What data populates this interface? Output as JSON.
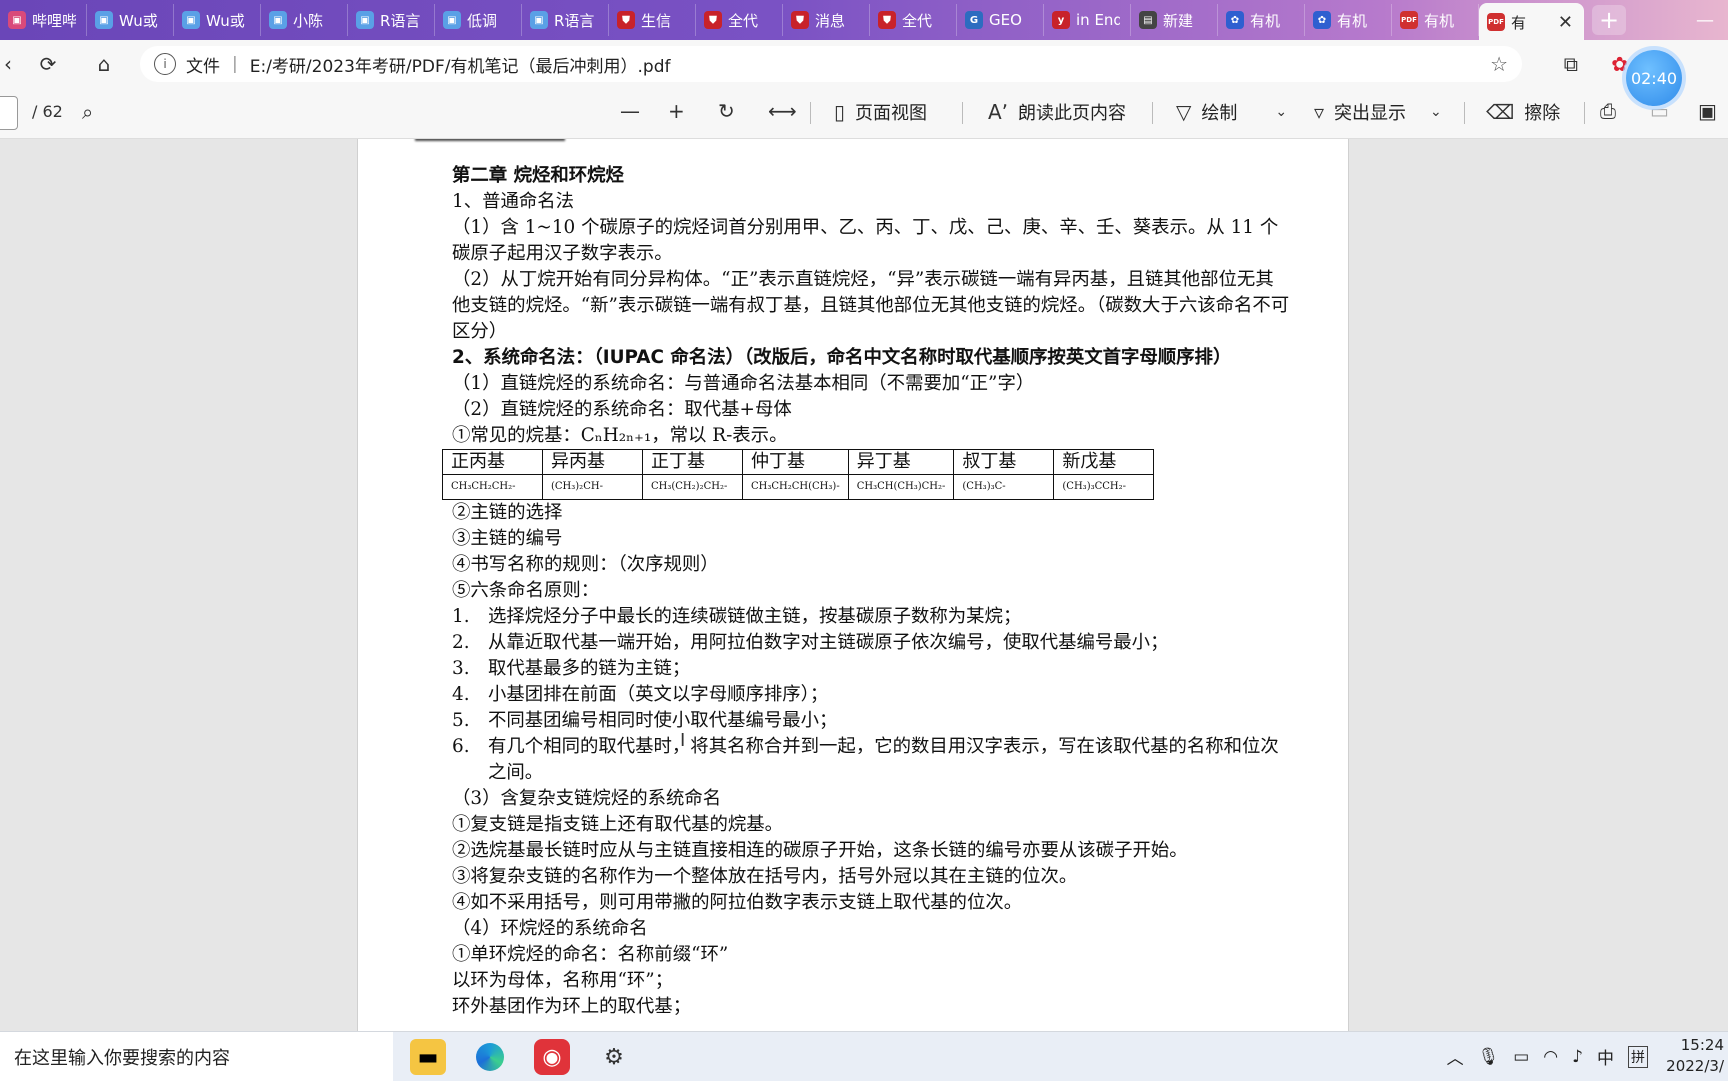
{
  "tabs": [
    {
      "label": "哔哩哔",
      "icon_color": "#d94a7a",
      "icon": "tv-icon"
    },
    {
      "label": "Wu或",
      "icon_color": "#5aa0e6",
      "icon": "tv-icon"
    },
    {
      "label": "Wu或",
      "icon_color": "#5aa0e6",
      "icon": "tv-icon"
    },
    {
      "label": "小陈",
      "icon_color": "#5aa0e6",
      "icon": "tv-icon"
    },
    {
      "label": "R语言",
      "icon_color": "#5aa0e6",
      "icon": "tv-icon"
    },
    {
      "label": "低调",
      "icon_color": "#5aa0e6",
      "icon": "tv-icon"
    },
    {
      "label": "R语言",
      "icon_color": "#5aa0e6",
      "icon": "tv-icon"
    },
    {
      "label": "生信",
      "icon_color": "#c8222a",
      "icon": "shield-icon"
    },
    {
      "label": "全代",
      "icon_color": "#c8222a",
      "icon": "shield-icon"
    },
    {
      "label": "消息",
      "icon_color": "#c8222a",
      "icon": "shield-icon"
    },
    {
      "label": "全代",
      "icon_color": "#c8222a",
      "icon": "shield-icon"
    },
    {
      "label": "GEO",
      "icon_color": "#2d6cc0",
      "icon": "geo-icon"
    },
    {
      "label": "in End",
      "icon_color": "#c8222a",
      "icon": "y-icon"
    },
    {
      "label": "新建",
      "icon_color": "#444444",
      "icon": "doc-icon"
    },
    {
      "label": "有机",
      "icon_color": "#2f5fd0",
      "icon": "paw-icon"
    },
    {
      "label": "有机",
      "icon_color": "#2f5fd0",
      "icon": "paw-icon"
    },
    {
      "label": "有机",
      "icon_color": "#d03030",
      "icon": "pdf-icon"
    }
  ],
  "active_tab": {
    "label": "有",
    "icon": "pdf-icon",
    "close": "✕"
  },
  "new_tab": "+",
  "address": {
    "info_label": "文件",
    "url": "E:/考研/2023年考研/PDF/有机笔记（最后冲刺用）.pdf"
  },
  "timer": "02:40",
  "pdf_toolbar": {
    "page_total": "/ 62",
    "page_view": "页面视图",
    "read_aloud": "朗读此页内容",
    "draw": "绘制",
    "highlight": "突出显示",
    "erase": "擦除"
  },
  "document": {
    "chapter_title": "第二章  烷烃和环烷烃",
    "lines": [
      "1、普通命名法",
      "（1）含 1~10 个碳原子的烷烃词首分别用甲、乙、丙、丁、戊、己、庚、辛、壬、葵表示。从 11 个碳原子起用汉子数字表示。",
      "（2）从丁烷开始有同分异构体。“正”表示直链烷烃，“异”表示碳链一端有异丙基，且链其他部位无其他支链的烷烃。“新”表示碳链一端有叔丁基，且链其他部位无其他支链的烷烃。（碳数大于六该命名不可区分）",
      "2、系统命名法：（IUPAC 命名法）（改版后，命名中文名称时取代基顺序按英文首字母顺序排）",
      "（1）直链烷烃的系统命名：与普通命名法基本相同（不需要加“正”字）",
      "（2）直链烷烃的系统命名：取代基+母体",
      "①常见的烷基：CₙH₂ₙ₊₁，常以 R-表示。"
    ],
    "table_headers": [
      "正丙基",
      "异丙基",
      "正丁基",
      "仲丁基",
      "异丁基",
      "叔丁基",
      "新戊基"
    ],
    "table_formulas": [
      "CH₃CH₂CH₂-",
      "(CH₃)₂CH-",
      "CH₃(CH₂)₂CH₂-",
      "CH₃CH₂CH(CH₃)-",
      "CH₃CH(CH₃)CH₂-",
      "(CH₃)₃C-",
      "(CH₃)₃CCH₂-"
    ],
    "lines_after_table": [
      "②主链的选择",
      "③主链的编号",
      "④书写名称的规则：（次序规则）",
      "⑤六条命名原则："
    ],
    "rules": [
      {
        "n": "1.",
        "t": "选择烷烃分子中最长的连续碳链做主链，按基碳原子数称为某烷；"
      },
      {
        "n": "2.",
        "t": "从靠近取代基一端开始，用阿拉伯数字对主链碳原子依次编号，使取代基编号最小；"
      },
      {
        "n": "3.",
        "t": "取代基最多的链为主链；"
      },
      {
        "n": "4.",
        "t": "小基团排在前面（英文以字母顺序排序）；"
      },
      {
        "n": "5.",
        "t": "不同基团编号相同时使小取代基编号最小；"
      },
      {
        "n": "6.",
        "t": "有几个相同的取代基时，将其名称合并到一起，它的数目用汉字表示，写在该取代基的名称和位次之间。"
      }
    ],
    "lines_end": [
      "（3）含复杂支链烷烃的系统命名",
      "①复支链是指支链上还有取代基的烷基。",
      "②选烷基最长链时应从与主链直接相连的碳原子开始，这条长链的编号亦要从该碳子开始。",
      "③将复杂支链的名称作为一个整体放在括号内，括号外冠以其在主链的位次。",
      "④如不采用括号，则可用带撇的阿拉伯数字表示支链上取代基的位次。",
      "（4）环烷烃的系统命名",
      "①单环烷烃的命名：名称前缀“环”",
      "以环为母体，名称用“环”；",
      "环外基团作为环上的取代基；"
    ]
  },
  "taskbar": {
    "search_placeholder": "在这里输入你要搜索的内容",
    "ime_lang": "中",
    "ime_mode": "拼",
    "time": "15:24",
    "date": "2022/3/"
  }
}
